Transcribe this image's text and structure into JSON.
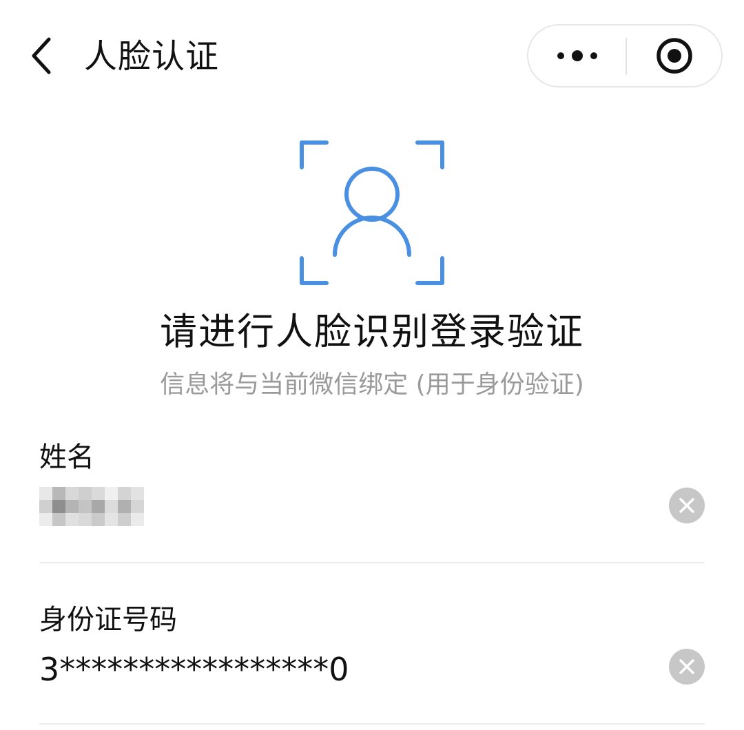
{
  "nav": {
    "title": "人脸认证",
    "back_icon": "chevron-left-icon",
    "more_icon": "more-dots-icon",
    "close_icon": "target-circle-icon"
  },
  "header": {
    "icon": "face-recognition-icon",
    "headline": "请进行人脸识别登录验证",
    "subline": "信息将与当前微信绑定 (用于身份验证)"
  },
  "form": {
    "name_label": "姓名",
    "name_value_pixelated": true,
    "id_label": "身份证号码",
    "id_value": "3*****************0",
    "clear_icon": "clear-x-icon"
  },
  "colors": {
    "accent": "#4a90e2",
    "text": "#111111",
    "muted": "#9a9a9a",
    "clear_bg": "#c7c7c7",
    "divider": "#ececec"
  }
}
